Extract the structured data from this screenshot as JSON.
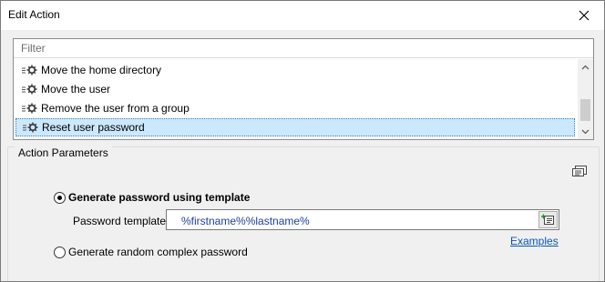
{
  "window": {
    "title": "Edit Action"
  },
  "filter": {
    "placeholder": "Filter"
  },
  "action_list": {
    "items": [
      {
        "label": "Move the home directory",
        "icon": "action-gear-icon",
        "selected": false
      },
      {
        "label": "Move the user",
        "icon": "action-gear-icon",
        "selected": false
      },
      {
        "label": "Remove the user from a group",
        "icon": "action-gear-icon",
        "selected": false
      },
      {
        "label": "Reset user password",
        "icon": "action-gear-icon",
        "selected": true
      }
    ]
  },
  "parameters": {
    "group_title": "Action Parameters",
    "option_template": {
      "label": "Generate password using template",
      "checked": true
    },
    "template_label": "Password template:",
    "template_value": "%firstname%%lastname%",
    "examples_link": "Examples",
    "option_random": {
      "label": "Generate random complex password",
      "checked": false
    }
  },
  "colors": {
    "selection": "#cce8ff",
    "link": "#0b54b4",
    "template_text": "#1a3fa0"
  }
}
